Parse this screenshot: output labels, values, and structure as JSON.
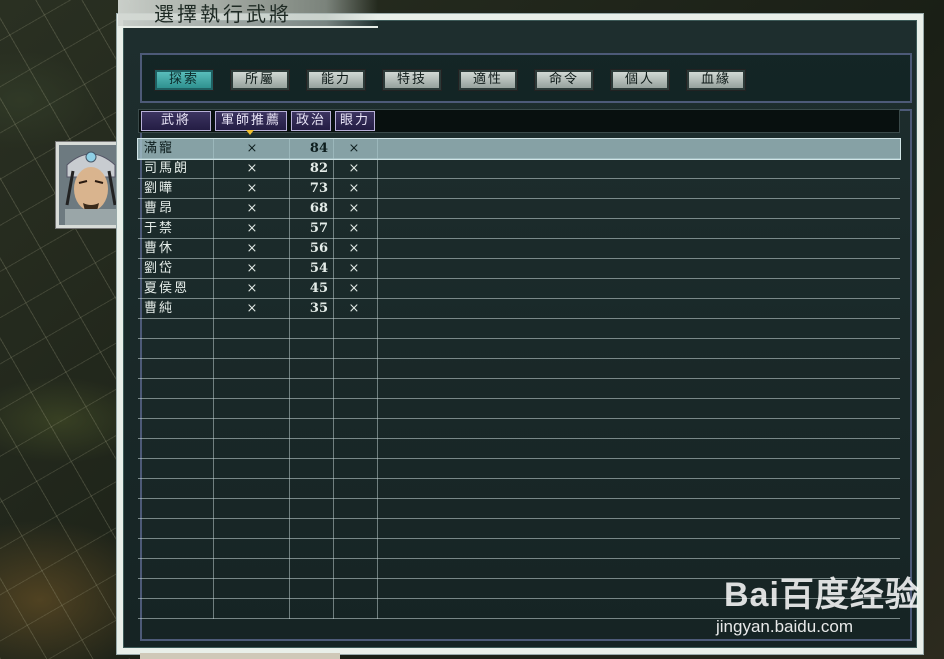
{
  "window": {
    "title": "選擇執行武將"
  },
  "tabs": [
    {
      "label": "探索",
      "active": true
    },
    {
      "label": "所屬",
      "active": false
    },
    {
      "label": "能力",
      "active": false
    },
    {
      "label": "特技",
      "active": false
    },
    {
      "label": "適性",
      "active": false
    },
    {
      "label": "命令",
      "active": false
    },
    {
      "label": "個人",
      "active": false
    },
    {
      "label": "血緣",
      "active": false
    }
  ],
  "columns": [
    {
      "label": "武將"
    },
    {
      "label": "軍師推薦",
      "sorted": true
    },
    {
      "label": "政治"
    },
    {
      "label": "眼力"
    }
  ],
  "rows": [
    {
      "name": "滿寵",
      "recommend": "×",
      "politics": "84",
      "eye": "×",
      "selected": true
    },
    {
      "name": "司馬朗",
      "recommend": "×",
      "politics": "82",
      "eye": "×"
    },
    {
      "name": "劉曄",
      "recommend": "×",
      "politics": "73",
      "eye": "×"
    },
    {
      "name": "曹昂",
      "recommend": "×",
      "politics": "68",
      "eye": "×"
    },
    {
      "name": "于禁",
      "recommend": "×",
      "politics": "57",
      "eye": "×"
    },
    {
      "name": "曹休",
      "recommend": "×",
      "politics": "56",
      "eye": "×"
    },
    {
      "name": "劉岱",
      "recommend": "×",
      "politics": "54",
      "eye": "×"
    },
    {
      "name": "夏侯恩",
      "recommend": "×",
      "politics": "45",
      "eye": "×"
    },
    {
      "name": "曹純",
      "recommend": "×",
      "politics": "35",
      "eye": "×"
    }
  ],
  "watermark": {
    "logo": "Bai百度经验",
    "url": "jingyan.baidu.com"
  },
  "colors": {
    "active_tab": "#3aa6a4",
    "header": "#2c2450",
    "selected_row": "#aac8cd"
  }
}
